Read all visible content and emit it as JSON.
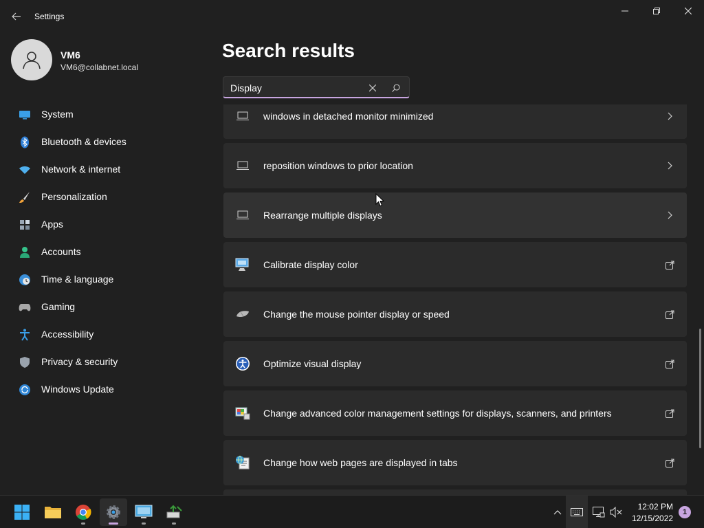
{
  "window": {
    "title": "Settings",
    "back_icon": "back-arrow-icon",
    "controls": [
      "minimize-icon",
      "maximize-icon",
      "close-icon"
    ]
  },
  "profile": {
    "name": "VM6",
    "email": "VM6@collabnet.local",
    "avatar_icon": "person-icon"
  },
  "sidebar": {
    "items": [
      {
        "label": "System",
        "icon": "system-icon"
      },
      {
        "label": "Bluetooth & devices",
        "icon": "bluetooth-icon"
      },
      {
        "label": "Network & internet",
        "icon": "wifi-icon"
      },
      {
        "label": "Personalization",
        "icon": "brush-icon"
      },
      {
        "label": "Apps",
        "icon": "apps-icon"
      },
      {
        "label": "Accounts",
        "icon": "accounts-icon"
      },
      {
        "label": "Time & language",
        "icon": "globe-clock-icon"
      },
      {
        "label": "Gaming",
        "icon": "gamepad-icon"
      },
      {
        "label": "Accessibility",
        "icon": "accessibility-icon"
      },
      {
        "label": "Privacy & security",
        "icon": "shield-icon"
      },
      {
        "label": "Windows Update",
        "icon": "update-icon"
      }
    ]
  },
  "main": {
    "title": "Search results",
    "search": {
      "value": "Display",
      "clear_icon": "clear-icon",
      "search_icon": "search-icon"
    },
    "results": [
      {
        "label": "windows in detached monitor minimized",
        "icon": "laptop-icon",
        "action": "chevron-right-icon"
      },
      {
        "label": "reposition windows to prior location",
        "icon": "laptop-icon",
        "action": "chevron-right-icon"
      },
      {
        "label": "Rearrange multiple displays",
        "icon": "laptop-icon",
        "action": "chevron-right-icon"
      },
      {
        "label": "Calibrate display color",
        "icon": "display-calibration-icon",
        "action": "open-external-icon"
      },
      {
        "label": "Change the mouse pointer display or speed",
        "icon": "mouse-icon",
        "action": "open-external-icon"
      },
      {
        "label": "Optimize visual display",
        "icon": "ease-of-access-icon",
        "action": "open-external-icon"
      },
      {
        "label": "Change advanced color management settings for displays, scanners, and printers",
        "icon": "color-management-icon",
        "action": "open-external-icon"
      },
      {
        "label": "Change how web pages are displayed in tabs",
        "icon": "internet-options-icon",
        "action": "open-external-icon"
      }
    ]
  },
  "taskbar": {
    "apps": [
      {
        "name": "Start",
        "icon": "windows-start-icon"
      },
      {
        "name": "File Explorer",
        "icon": "folder-icon"
      },
      {
        "name": "Google Chrome",
        "icon": "chrome-icon"
      },
      {
        "name": "Settings",
        "icon": "settings-gear-icon"
      },
      {
        "name": "Remote Desktop",
        "icon": "remote-desktop-icon"
      },
      {
        "name": "Network tool",
        "icon": "network-tool-icon"
      }
    ],
    "tray": [
      "chevron-up-icon",
      "keyboard-icon",
      "network-icon",
      "volume-muted-icon"
    ],
    "clock": {
      "time": "12:02 PM",
      "date": "12/15/2022"
    },
    "notifications": "1"
  },
  "colors": {
    "background": "#202020",
    "card": "#2b2b2b",
    "accent": "#c8a5e0",
    "taskbar": "#1c1c1c"
  }
}
